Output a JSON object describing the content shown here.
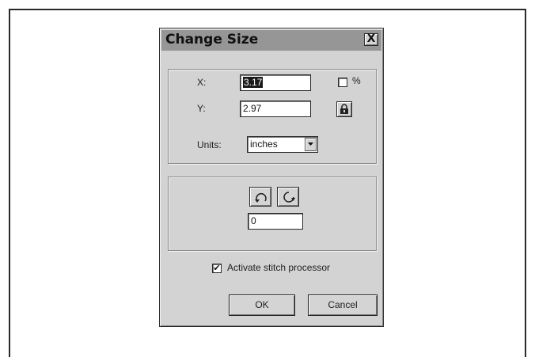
{
  "dialog": {
    "title": "Change Size",
    "close_label": "X",
    "size_group": {
      "x_label": "X:",
      "x_value": "3.17",
      "y_label": "Y:",
      "y_value": "2.97",
      "percent_label": "%",
      "percent_checked": false,
      "units_label": "Units:",
      "units_value": "inches"
    },
    "rotate_group": {
      "angle_value": "0"
    },
    "stitch_processor": {
      "label": "Activate stitch processor",
      "checked": true,
      "check_glyph": "✔"
    },
    "buttons": {
      "ok_label": "OK",
      "cancel_label": "Cancel"
    }
  },
  "icons": {
    "lock": "lock-icon",
    "rotate_left": "rotate-counterclockwise-icon",
    "rotate_right": "rotate-clockwise-icon",
    "dropdown": "chevron-down-icon"
  }
}
